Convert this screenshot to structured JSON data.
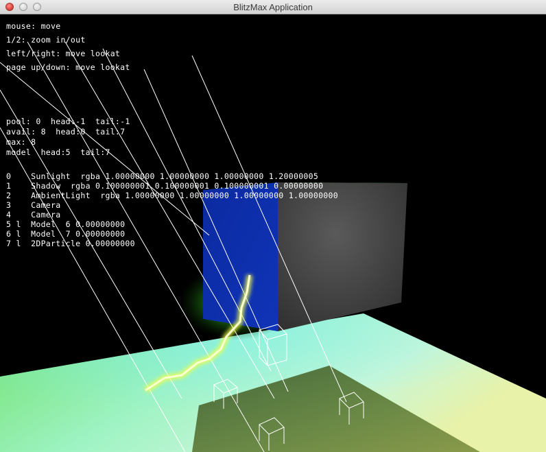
{
  "window": {
    "title": "BlitzMax Application",
    "buttons": {
      "close": "close",
      "minimize": "minimize",
      "zoom": "zoom"
    }
  },
  "help": {
    "mouse": "mouse: move",
    "zoom": "1/2: zoom in/out",
    "lookat": "left/right: move lookat",
    "pageupdown": "page up/down: move lookat"
  },
  "stats": {
    "pool": "pool: 0  head:-1  tail:-1",
    "avail": "avail: 8  head:0  tail:7",
    "max": "max: 8",
    "model": "model  head:5  tail:7"
  },
  "entities": [
    "0    Sunlight  rgba 1.00000000 1.00000000 1.00000000 1.20000005",
    "1    Shadow  rgba 0.100000001 0.100000001 0.100000001 0.00000000",
    "2    AmbientLight  rgba 1.00000000 1.00000000 1.00000000 1.00000000",
    "3    Camera",
    "4    Camera",
    "5 l  Model  6 0.00000000",
    "6 l  Model  7 0.00000000",
    "7 l  2DParticle 0.00000000"
  ],
  "colors": {
    "background": "#000000",
    "hud_text": "#ffffff",
    "cube_left": "#0a2a9e",
    "cube_front": "#3c3c3c",
    "cube_top": "#2cd52c",
    "floor_light": "#9af5c0",
    "floor_patch": "#5e7a40",
    "lightning": "#f4ff9a"
  }
}
